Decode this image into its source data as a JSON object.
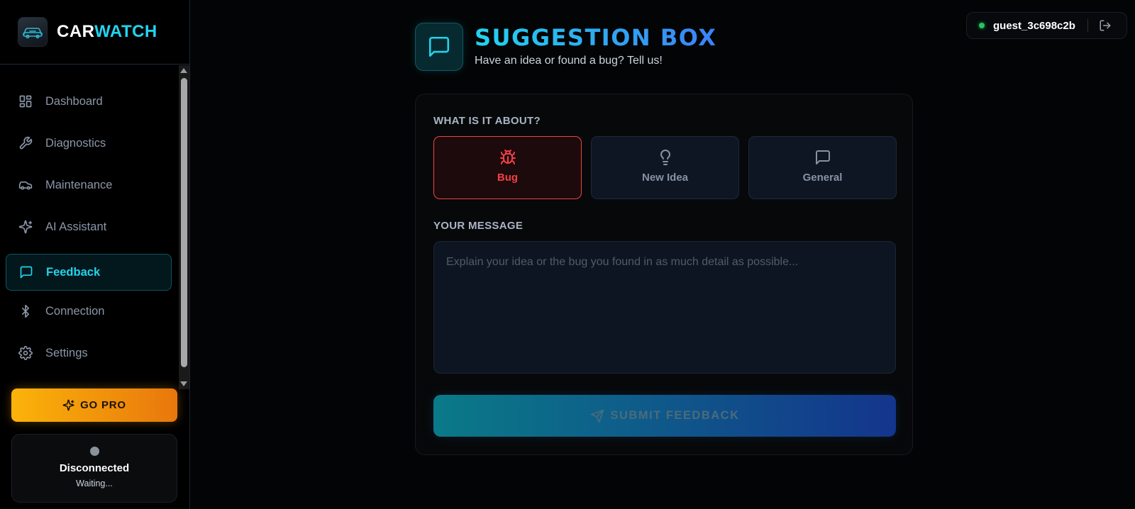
{
  "brand": {
    "part1": "CAR",
    "part2": "WATCH"
  },
  "sidebar": {
    "items": [
      {
        "label": "Dashboard",
        "icon": "dashboard-icon"
      },
      {
        "label": "Diagnostics",
        "icon": "wrench-icon"
      },
      {
        "label": "Maintenance",
        "icon": "car-icon"
      },
      {
        "label": "AI Assistant",
        "icon": "sparkles-icon"
      },
      {
        "label": "Feedback",
        "icon": "message-square-icon",
        "active": true
      },
      {
        "label": "Connection",
        "icon": "bluetooth-icon"
      },
      {
        "label": "Settings",
        "icon": "gear-icon"
      }
    ],
    "go_pro_label": "GO PRO"
  },
  "connection": {
    "status": "Disconnected",
    "sub": "Waiting..."
  },
  "user": {
    "name": "guest_3c698c2b",
    "online_color": "#22c55e"
  },
  "header": {
    "title": "SUGGESTION BOX",
    "subtitle": "Have an idea or found a bug? Tell us!"
  },
  "form": {
    "type_label": "WHAT IS IT ABOUT?",
    "types": [
      {
        "label": "Bug",
        "icon": "bug-icon",
        "selected": true
      },
      {
        "label": "New Idea",
        "icon": "lightbulb-icon",
        "selected": false
      },
      {
        "label": "General",
        "icon": "message-square-icon",
        "selected": false
      }
    ],
    "message_label": "YOUR MESSAGE",
    "message_value": "",
    "message_placeholder": "Explain your idea or the bug you found in as much detail as possible...",
    "submit_label": "SUBMIT FEEDBACK"
  },
  "colors": {
    "accent": "#22d3ee",
    "selected_border": "#ef4444",
    "pro_gradient_start": "#fbb30a",
    "pro_gradient_end": "#e8770c"
  }
}
